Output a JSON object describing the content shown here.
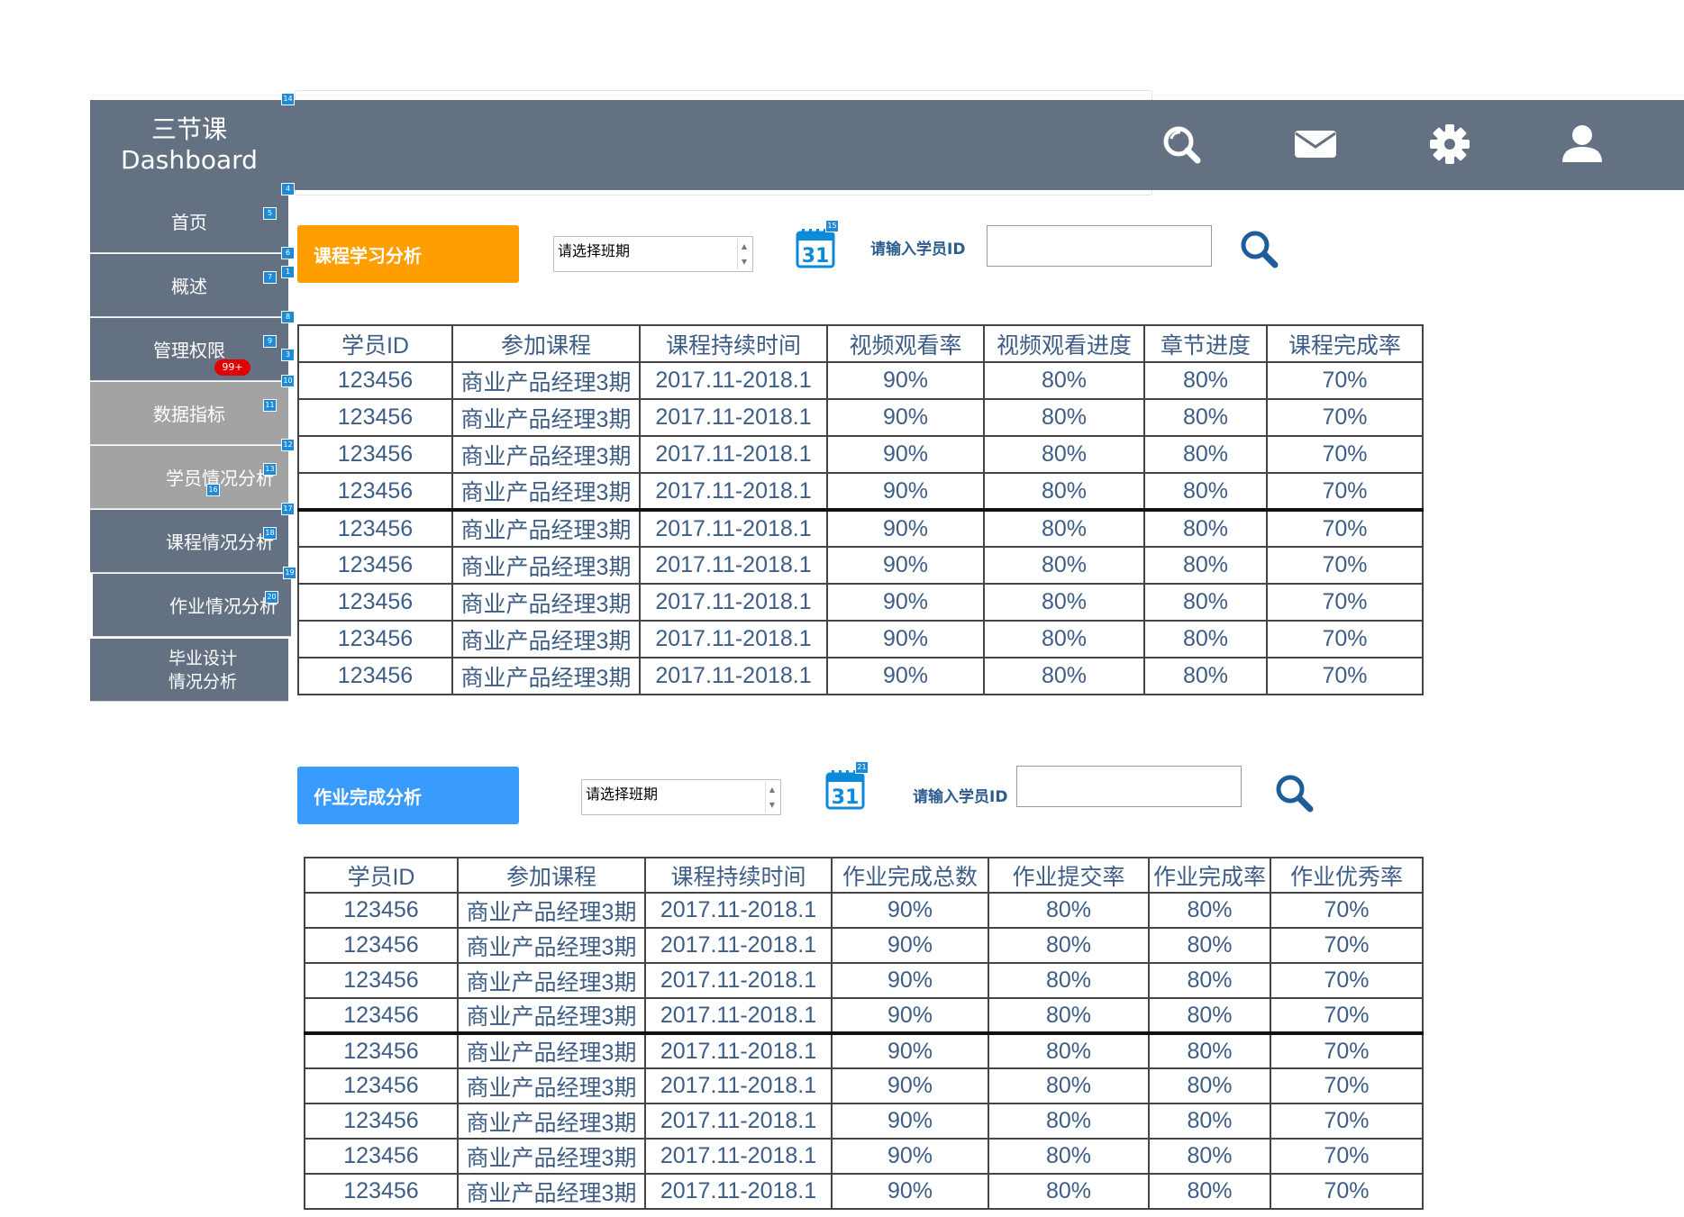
{
  "brand": {
    "line1": "三节课",
    "line2": "Dashboard"
  },
  "sidebar": {
    "items": [
      {
        "label": "首页"
      },
      {
        "label": "概述"
      },
      {
        "label": "管理权限",
        "badge": "99+"
      },
      {
        "label": "数据指标"
      },
      {
        "label": "学员情况分析"
      },
      {
        "label": "课程情况分析"
      },
      {
        "label": "作业情况分析"
      },
      {
        "label": "毕业设计",
        "label2": "情况分析"
      }
    ]
  },
  "topicons": [
    "search-icon",
    "mail-icon",
    "gear-icon",
    "user-icon"
  ],
  "section1": {
    "title": "课程学习分析",
    "title_color": "#ff9e00",
    "select_value": "请选择班期",
    "calendar_day": "31",
    "id_label": "请输入学员ID",
    "id_value": "",
    "headers": [
      "学员ID",
      "参加课程",
      "课程持续时间",
      "视频观看率",
      "视频观看进度",
      "章节进度",
      "课程完成率"
    ],
    "rows": [
      [
        "123456",
        "商业产品经理3期",
        "2017.11-2018.1",
        "90%",
        "80%",
        "80%",
        "70%"
      ],
      [
        "123456",
        "商业产品经理3期",
        "2017.11-2018.1",
        "90%",
        "80%",
        "80%",
        "70%"
      ],
      [
        "123456",
        "商业产品经理3期",
        "2017.11-2018.1",
        "90%",
        "80%",
        "80%",
        "70%"
      ],
      [
        "123456",
        "商业产品经理3期",
        "2017.11-2018.1",
        "90%",
        "80%",
        "80%",
        "70%"
      ],
      [
        "123456",
        "商业产品经理3期",
        "2017.11-2018.1",
        "90%",
        "80%",
        "80%",
        "70%"
      ],
      [
        "123456",
        "商业产品经理3期",
        "2017.11-2018.1",
        "90%",
        "80%",
        "80%",
        "70%"
      ],
      [
        "123456",
        "商业产品经理3期",
        "2017.11-2018.1",
        "90%",
        "80%",
        "80%",
        "70%"
      ],
      [
        "123456",
        "商业产品经理3期",
        "2017.11-2018.1",
        "90%",
        "80%",
        "80%",
        "70%"
      ],
      [
        "123456",
        "商业产品经理3期",
        "2017.11-2018.1",
        "90%",
        "80%",
        "80%",
        "70%"
      ]
    ]
  },
  "section2": {
    "title": "作业完成分析",
    "title_color": "#3a9bff",
    "select_value": "请选择班期",
    "calendar_day": "31",
    "id_label": "请输入学员ID",
    "id_value": "",
    "headers": [
      "学员ID",
      "参加课程",
      "课程持续时间",
      "作业完成总数",
      "作业提交率",
      "作业完成率",
      "作业优秀率"
    ],
    "rows": [
      [
        "123456",
        "商业产品经理3期",
        "2017.11-2018.1",
        "90%",
        "80%",
        "80%",
        "70%"
      ],
      [
        "123456",
        "商业产品经理3期",
        "2017.11-2018.1",
        "90%",
        "80%",
        "80%",
        "70%"
      ],
      [
        "123456",
        "商业产品经理3期",
        "2017.11-2018.1",
        "90%",
        "80%",
        "80%",
        "70%"
      ],
      [
        "123456",
        "商业产品经理3期",
        "2017.11-2018.1",
        "90%",
        "80%",
        "80%",
        "70%"
      ],
      [
        "123456",
        "商业产品经理3期",
        "2017.11-2018.1",
        "90%",
        "80%",
        "80%",
        "70%"
      ],
      [
        "123456",
        "商业产品经理3期",
        "2017.11-2018.1",
        "90%",
        "80%",
        "80%",
        "70%"
      ],
      [
        "123456",
        "商业产品经理3期",
        "2017.11-2018.1",
        "90%",
        "80%",
        "80%",
        "70%"
      ],
      [
        "123456",
        "商业产品经理3期",
        "2017.11-2018.1",
        "90%",
        "80%",
        "80%",
        "70%"
      ],
      [
        "123456",
        "商业产品经理3期",
        "2017.11-2018.1",
        "90%",
        "80%",
        "80%",
        "70%"
      ]
    ]
  },
  "annotation_markers": [
    "14",
    "4",
    "5",
    "6",
    "1",
    "7",
    "8",
    "9",
    "3",
    "10",
    "11",
    "12",
    "13",
    "16",
    "17",
    "18",
    "19",
    "20",
    "15",
    "21"
  ]
}
